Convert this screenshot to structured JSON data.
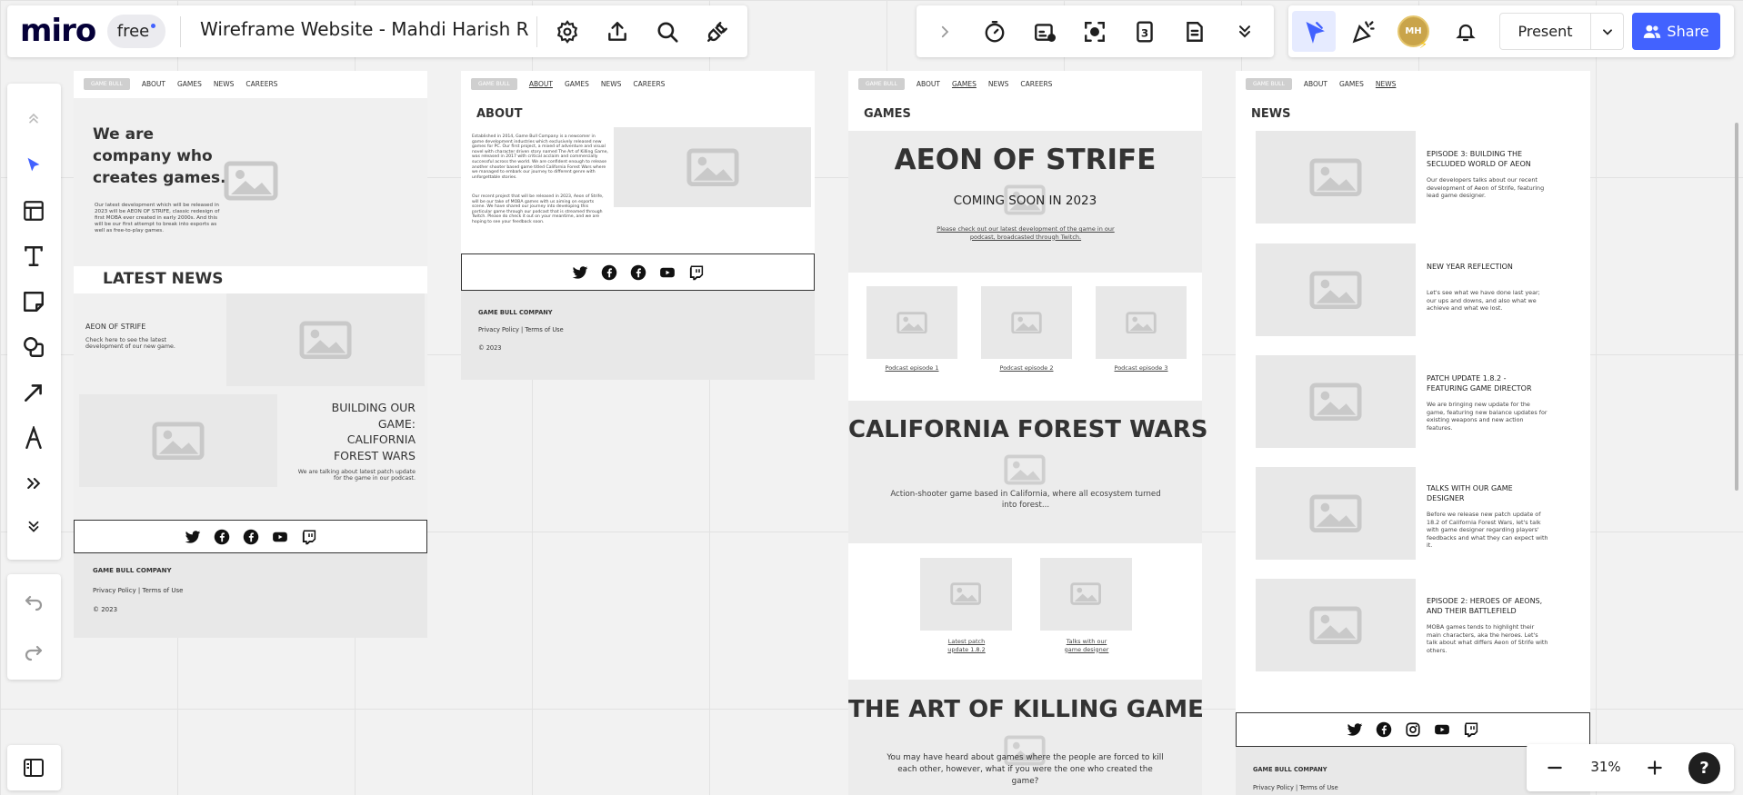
{
  "topbar": {
    "logo": "miro",
    "plan": "free",
    "board_title": "Wireframe Website - Mahdi Harish R",
    "present_label": "Present",
    "share_label": "Share",
    "avatar_initials": "MH",
    "zoom": "31%",
    "help": "?"
  },
  "colors": {
    "accent": "#4262ff",
    "selected_bg": "#e6ebff",
    "canvas": "#f2f2f2",
    "placeholder": "#e8e8e8"
  },
  "icons": {
    "top_left": [
      "settings-icon",
      "export-icon",
      "search-icon",
      "plugin-icon"
    ],
    "top_right": [
      "timer-icon",
      "card-icon",
      "focus-icon",
      "count-icon",
      "notes-icon",
      "more-icon"
    ],
    "left": [
      "select-icon",
      "frame-icon",
      "text-icon",
      "sticky-note-icon",
      "shapes-icon",
      "connector-icon",
      "pen-icon",
      "more-tools-icon",
      "collapse-icon"
    ]
  },
  "common": {
    "logo_btn": "GAME BULL",
    "nav": [
      "ABOUT",
      "GAMES",
      "NEWS",
      "CAREERS"
    ],
    "footer_company": "GAME BULL COMPANY",
    "footer_links": "Privacy Policy | Terms of Use",
    "footer_year": "© 2023"
  },
  "home": {
    "hero": "We are company who creates games.",
    "hero_body": "Our latest development which will be released in 2023 will be AEON OF STRIFE, classic redesign of first MOBA ever created in early 2000s. And this will be our first attempt to break into esports as well as free-to-play games.",
    "latest_news": "LATEST NEWS",
    "news1_title": "AEON OF STRIFE",
    "news1_body": "Check here to see the latest development of our new game.",
    "news2_title": "BUILDING OUR GAME: CALIFORNIA FOREST WARS",
    "news2_body": "We are talking about latest patch update for the game in our podcast."
  },
  "about": {
    "heading": "ABOUT",
    "p1": "Established in 2014, Game Bull Company is a newcomer in game development industries which exclusively released new games for PC. Our first project, a mixed of adventure and visual novel with character driven story named The Art of Killing Game, was released in 2017 with critical acclaim and commercially successful across the world. We are confident enough to release another shooter based game titled California Forest Wars where we managed to embark our journey to different genre with unforgettable stories.",
    "p2": "Our recent project that will be released in 2023, Aeon of Strife, will be our take of MOBA games with us aiming on esports scene. We have shared our journey into developing this particular game through our podcast that is streamed through Twitch. Please do check it out on your meantime, and we are hoping to see your feedback soon."
  },
  "games": {
    "heading": "GAMES",
    "g1_title": "AEON OF STRIFE",
    "g1_sub": "COMING SOON IN 2023",
    "g1_link": "Please check out our latest development of the game in our podcast, broadcasted through Twitch.",
    "podcasts": [
      "Podcast episode 1",
      "Podcast episode 2",
      "Podcast episode 3"
    ],
    "g2_title": "CALIFORNIA FOREST WARS",
    "g2_body": "Action-shooter game based in California, where all ecosystem turned into forest...",
    "g2_links": [
      "Latest patch update 1.8.2",
      "Talks with our game designer"
    ],
    "g3_title": "THE ART OF KILLING GAME",
    "g3_body": "You may have heard about games where the people are forced to kill each other, however, what if you were the one who created the game?"
  },
  "news": {
    "heading": "NEWS",
    "items": [
      {
        "title": "EPISODE 3: BUILDING THE SECLUDED WORLD OF AEON",
        "body": "Our developers talks about our recent development of Aeon of Strife, featuring lead game designer."
      },
      {
        "title": "NEW YEAR REFLECTION",
        "body": "Let's see what we have done last year; our ups and downs, and also what we achieve and what we lost."
      },
      {
        "title": "PATCH UPDATE 1.8.2 - FEATURING GAME DIRECTOR",
        "body": "We are bringing new update for the game, featuring new balance updates for existing weapons and new action features."
      },
      {
        "title": "TALKS WITH OUR GAME DESIGNER",
        "body": "Before we release new patch update of 18.2 of California Forest Wars, let's talk with game designer regarding players' feedbacks and what they can expect with it."
      },
      {
        "title": "EPISODE 2: HEROES OF AEONS, AND THEIR BATTLEFIELD",
        "body": "MOBA games tends to highlight their main characters, aka the heroes. Let's talk about what differs Aeon of Strife with others."
      }
    ]
  }
}
